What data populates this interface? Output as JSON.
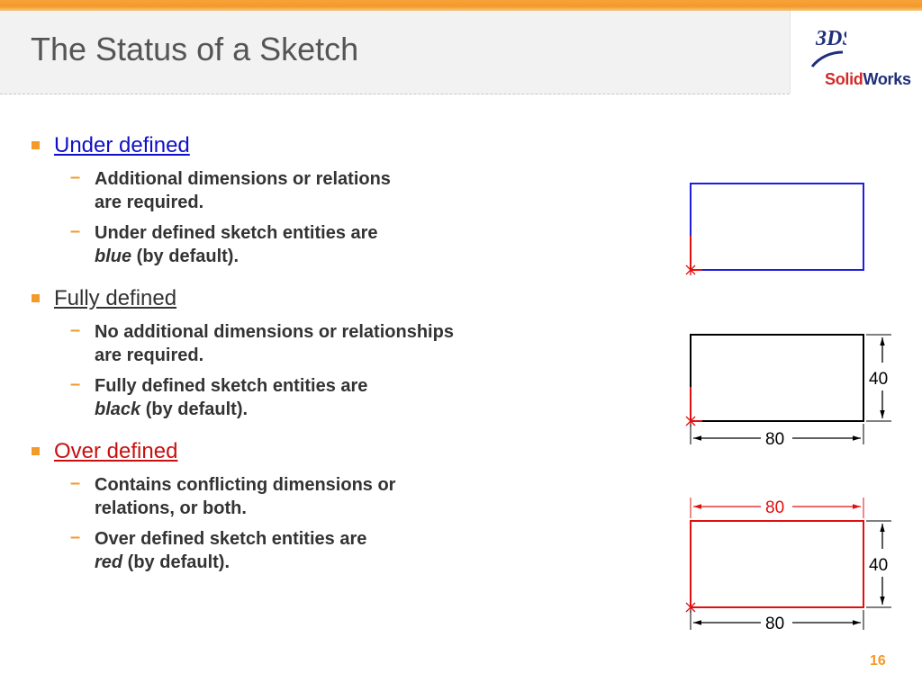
{
  "slide": {
    "title": "The Status of a Sketch",
    "page_number": "16"
  },
  "logo": {
    "mark": "3DS",
    "solid": "Solid",
    "works": "Works"
  },
  "colors": {
    "accent": "#f39a2a",
    "under_defined": "#1010c8",
    "fully_defined": "#333333",
    "over_defined": "#c81010",
    "sketch_blue": "#1e1edc",
    "sketch_black": "#000000",
    "sketch_red": "#e01010"
  },
  "sections": [
    {
      "heading": "Under defined",
      "items": [
        {
          "line1": "Additional dimensions or relations",
          "line2": "are required."
        },
        {
          "line1": "Under defined sketch entities are",
          "line2_em": "blue",
          "line2_rest": " (by default)."
        }
      ]
    },
    {
      "heading": "Fully defined",
      "items": [
        {
          "line1": "No additional dimensions or relationships",
          "line2": "are required."
        },
        {
          "line1": "Fully defined sketch entities are",
          "line2_em": "black",
          "line2_rest": " (by default)."
        }
      ]
    },
    {
      "heading": "Over defined",
      "items": [
        {
          "line1": "Contains conflicting dimensions or",
          "line2": "relations, or both."
        },
        {
          "line1": "Over defined sketch entities are",
          "line2_em": "red",
          "line2_rest": " (by default)."
        }
      ]
    }
  ],
  "diagrams": {
    "fully_defined": {
      "width_label": "80",
      "height_label": "40"
    },
    "over_defined": {
      "top_width_label": "80",
      "height_label": "40",
      "bottom_width_label": "80"
    }
  }
}
